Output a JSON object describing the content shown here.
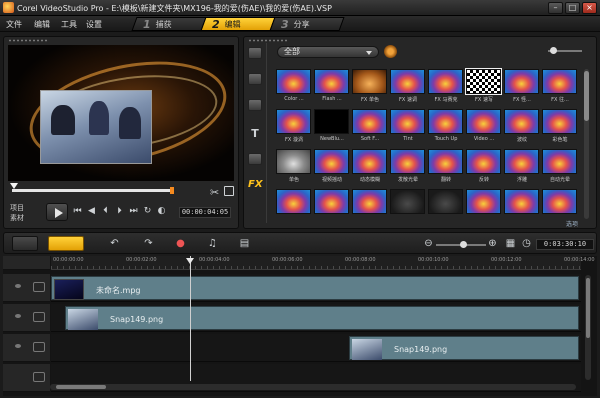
{
  "window": {
    "title": "Corel VideoStudio Pro - E:\\模板\\新建文件夹\\MX196-我的爱(伤AE)\\我的爱(伤AE).VSP"
  },
  "menu": {
    "items": [
      "文件",
      "编辑",
      "工具",
      "设置"
    ]
  },
  "steps": [
    {
      "num": "1",
      "label": "捕获",
      "active": false
    },
    {
      "num": "2",
      "label": "编辑",
      "active": true
    },
    {
      "num": "3",
      "label": "分享",
      "active": false
    }
  ],
  "preview": {
    "mode_project": "项目",
    "mode_clip": "素材",
    "timecode": "00:00:04:05",
    "controls": [
      "home",
      "prev-frame",
      "prev",
      "next",
      "next-frame",
      "repeat",
      "volume"
    ]
  },
  "library": {
    "category": "全部",
    "options_label": "选项",
    "side_tabs": [
      "media",
      "transition",
      "title",
      "graphic",
      "FX"
    ],
    "items": [
      {
        "label": "Color ...",
        "style": "normal"
      },
      {
        "label": "Flash ...",
        "style": "normal"
      },
      {
        "label": "FX 单色",
        "style": "orange"
      },
      {
        "label": "FX 速调",
        "style": "normal"
      },
      {
        "label": "FX 马赛克",
        "style": "normal"
      },
      {
        "label": "FX 速写",
        "style": "pattern"
      },
      {
        "label": "FX 怪...",
        "style": "normal"
      },
      {
        "label": "FX 往...",
        "style": "normal"
      },
      {
        "label": "FX 漩涡",
        "style": "normal"
      },
      {
        "label": "NewBlu...",
        "style": "black"
      },
      {
        "label": "Soft F...",
        "style": "normal"
      },
      {
        "label": "Tint",
        "style": "normal"
      },
      {
        "label": "Touch Up",
        "style": "normal"
      },
      {
        "label": "Video ...",
        "style": "normal"
      },
      {
        "label": "波纹",
        "style": "normal"
      },
      {
        "label": "彩色笔",
        "style": "normal"
      },
      {
        "label": "单色",
        "style": "gray"
      },
      {
        "label": "视频摇动",
        "style": "normal"
      },
      {
        "label": "动态模糊",
        "style": "normal"
      },
      {
        "label": "发散光晕",
        "style": "normal"
      },
      {
        "label": "翻转",
        "style": "normal"
      },
      {
        "label": "反转",
        "style": "normal"
      },
      {
        "label": "浮雕",
        "style": "normal"
      },
      {
        "label": "自动光晕",
        "style": "normal"
      },
      {
        "label": "",
        "style": "normal"
      },
      {
        "label": "",
        "style": "normal"
      },
      {
        "label": "",
        "style": "normal"
      },
      {
        "label": "",
        "style": "dark"
      },
      {
        "label": "",
        "style": "dark"
      },
      {
        "label": "",
        "style": "normal"
      },
      {
        "label": "",
        "style": "normal"
      },
      {
        "label": "",
        "style": "normal"
      }
    ]
  },
  "timeline": {
    "timecode": "0:03:30:10",
    "ruler": [
      "00:00:00:00",
      "00:00:02:00",
      "00:00:04:00",
      "00:00:06:00",
      "00:00:08:00",
      "00:00:10:00",
      "00:00:12:00",
      "00:00:14:00"
    ],
    "tracks": [
      {
        "name": "video",
        "clips": [
          {
            "label": "未命名.mpg",
            "kind": "video"
          }
        ]
      },
      {
        "name": "overlay-1",
        "clips": [
          {
            "label": "Snap149.png",
            "kind": "image"
          }
        ]
      },
      {
        "name": "overlay-2",
        "clips": [
          {
            "label": "Snap149.png",
            "kind": "image"
          }
        ]
      }
    ]
  }
}
